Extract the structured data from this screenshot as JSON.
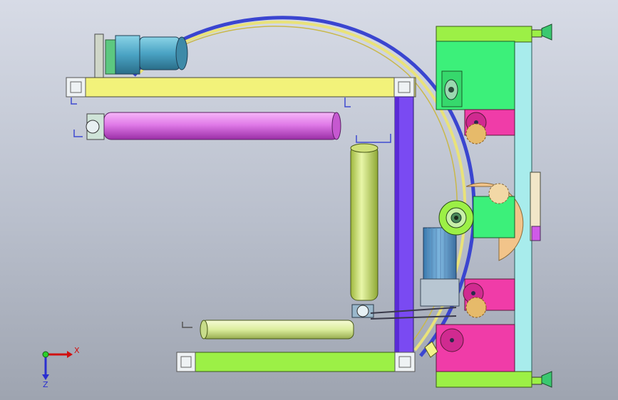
{
  "triad": {
    "x_label": "X",
    "z_label": "Z"
  },
  "colors": {
    "background_top": "#d7dbe6",
    "background_bottom": "#9ea4b0",
    "ring_outer": "#3a45d0",
    "ring_track": "#e9e27a",
    "top_frame": "#f2f27a",
    "bottom_frame": "#9cf046",
    "side_post": "#7a4af2",
    "top_roller": "#e07ae8",
    "vertical_roller": "#d8ec8a",
    "bottom_roller": "#e0f0a6",
    "right_housing": "#3cf07a",
    "right_plate": "#a8ecec",
    "pink_block": "#f03ca8",
    "motor_top": "#5fbdd2",
    "motor_mid": "#4a94c6",
    "gear_orange": "#f2c48a",
    "yellow_tab": "#f2f28a"
  }
}
